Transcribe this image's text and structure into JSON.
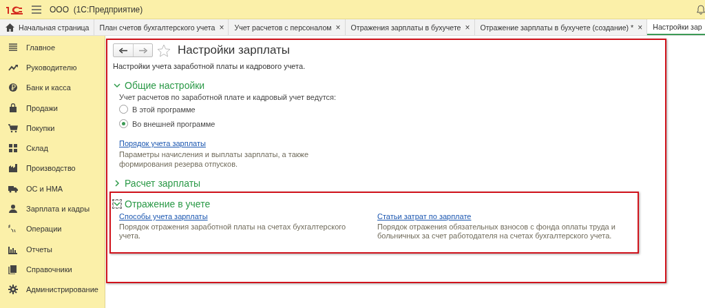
{
  "app": {
    "title": "ООО  (1С:Предприятие)"
  },
  "tabs": [
    {
      "label": "Начальная страница",
      "selected": false,
      "kind": "home"
    },
    {
      "label": "План счетов бухгалтерского учета",
      "selected": false,
      "kind": "doc",
      "close": "×"
    },
    {
      "label": "Учет расчетов с персоналом",
      "selected": false,
      "kind": "doc",
      "close": "×"
    },
    {
      "label": "Отражения зарплаты в бухучете",
      "selected": false,
      "kind": "doc",
      "close": "×"
    },
    {
      "label": "Отражение зарплаты в бухучете (создание) *",
      "selected": false,
      "kind": "doc",
      "close": "×"
    },
    {
      "label": "Настройки зар",
      "selected": true,
      "kind": "doc"
    }
  ],
  "sidebar": {
    "items": [
      {
        "label": "Главное"
      },
      {
        "label": "Руководителю"
      },
      {
        "label": "Банк и касса"
      },
      {
        "label": "Продажи"
      },
      {
        "label": "Покупки"
      },
      {
        "label": "Склад"
      },
      {
        "label": "Производство"
      },
      {
        "label": "ОС и НМА"
      },
      {
        "label": "Зарплата и кадры"
      },
      {
        "label": "Операции"
      },
      {
        "label": "Отчеты"
      },
      {
        "label": "Справочники"
      },
      {
        "label": "Администрирование"
      }
    ]
  },
  "form": {
    "title": "Настройки зарплаты",
    "favorite": false,
    "description": "Настройки учета заработной платы и кадрового учета.",
    "sections": [
      {
        "title": "Общие настройки",
        "expanded": true,
        "focused": false,
        "highlighted": false,
        "kind": "options",
        "label": "Учет расчетов по заработной плате и кадровый учет ведутся:",
        "radios": [
          {
            "label": "В этой программе",
            "selected": false
          },
          {
            "label": "Во внешней программе",
            "selected": true
          }
        ],
        "links": [
          {
            "link": "Порядок учета зарплаты",
            "description": "Параметры начисления и выплаты зарплаты, а также формирования резерва отпусков."
          }
        ]
      },
      {
        "title": "Расчет зарплаты",
        "expanded": false,
        "focused": false,
        "highlighted": false,
        "kind": "options"
      },
      {
        "title": "Отражение в учете",
        "expanded": true,
        "focused": true,
        "highlighted": true,
        "kind": "columns",
        "links": [
          {
            "link": "Способы учета зарплаты",
            "description": "Порядок отражения заработной платы на счетах бухгалтерского учета."
          },
          {
            "link": "Статьи затрат по зарплате",
            "description": "Порядок отражения обязательных взносов с фонда оплаты труда и больничных за счет работодателя на счетах бухгалтерского учета."
          }
        ]
      }
    ]
  }
}
